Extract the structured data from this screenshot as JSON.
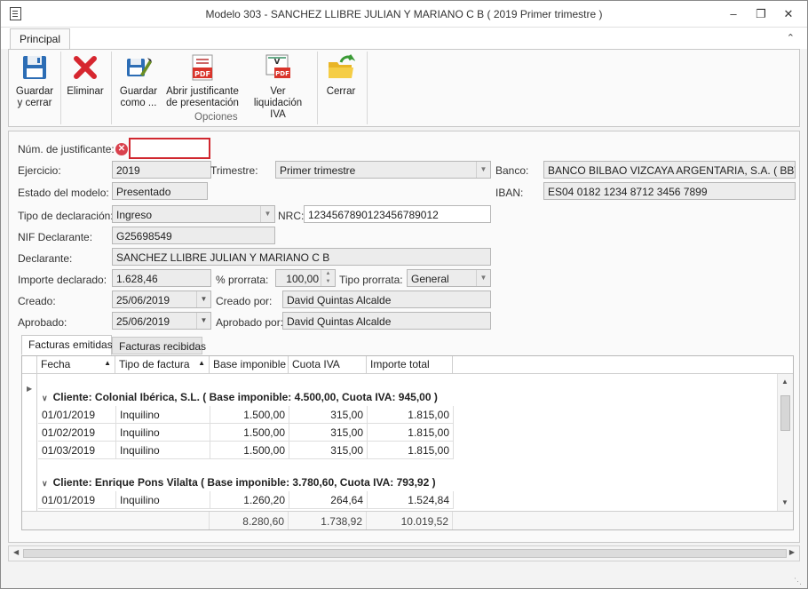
{
  "window": {
    "title": "Modelo 303 -  SANCHEZ LLIBRE JULIAN Y MARIANO C B ( 2019 Primer trimestre )"
  },
  "ribbon": {
    "tab": "Principal",
    "buttons": {
      "save_close": "Guardar\ny cerrar",
      "delete": "Eliminar",
      "save_as": "Guardar\ncomo ...",
      "open_justificante": "Abrir justificante\nde presentación",
      "ver_liquidacion": "Ver liquidación\nIVA",
      "close": "Cerrar"
    },
    "group_label": "Opciones"
  },
  "form": {
    "num_justificante_label": "Núm. de justificante:",
    "num_justificante_value": "",
    "ejercicio_label": "Ejercicio:",
    "ejercicio_value": "2019",
    "trimestre_label": "Trimestre:",
    "trimestre_value": "Primer trimestre",
    "banco_label": "Banco:",
    "banco_value": "BANCO BILBAO VIZCAYA ARGENTARIA, S.A. ( BBVAESMM",
    "estado_label": "Estado del modelo:",
    "estado_value": "Presentado",
    "iban_label": "IBAN:",
    "iban_value": "ES04 0182 1234 8712 3456 7899",
    "tipo_decl_label": "Tipo de declaración:",
    "tipo_decl_value": "Ingreso",
    "nrc_label": "NRC:",
    "nrc_value": "123456789012345678901​2",
    "nif_label": "NIF Declarante:",
    "nif_value": "G25698549",
    "declarante_label": "Declarante:",
    "declarante_value": "SANCHEZ LLIBRE JULIAN Y MARIANO C B",
    "importe_label": "Importe declarado:",
    "importe_value": "1.628,46",
    "prorrata_label": "% prorrata:",
    "prorrata_value": "100,00",
    "tipo_prorrata_label": "Tipo prorrata:",
    "tipo_prorrata_value": "General",
    "creado_label": "Creado:",
    "creado_value": "25/06/2019",
    "creado_por_label": "Creado por:",
    "creado_por_value": "David Quintas Alcalde",
    "aprobado_label": "Aprobado:",
    "aprobado_value": "25/06/2019",
    "aprobado_por_label": "Aprobado por:",
    "aprobado_por_value": "David Quintas Alcalde"
  },
  "tabs": [
    "Facturas emitidas",
    "Facturas recibidas"
  ],
  "grid": {
    "columns": [
      "Fecha",
      "Tipo de factura",
      "Base imponible",
      "Cuota IVA",
      "Importe total"
    ],
    "group1": "Cliente: Colonial Ibérica, S.L. ( Base imponible: 4.500,00, Cuota IVA: 945,00 )",
    "group1_rows": [
      [
        "01/01/2019",
        "Inquilino",
        "1.500,00",
        "315,00",
        "1.815,00"
      ],
      [
        "01/02/2019",
        "Inquilino",
        "1.500,00",
        "315,00",
        "1.815,00"
      ],
      [
        "01/03/2019",
        "Inquilino",
        "1.500,00",
        "315,00",
        "1.815,00"
      ]
    ],
    "group2": "Cliente: Enrique Pons Vilalta ( Base imponible: 3.780,60, Cuota IVA: 793,92 )",
    "group2_rows": [
      [
        "01/01/2019",
        "Inquilino",
        "1.260,20",
        "264,64",
        "1.524,84"
      ]
    ],
    "totals": [
      "8.280,60",
      "1.738,92",
      "10.019,52"
    ]
  }
}
